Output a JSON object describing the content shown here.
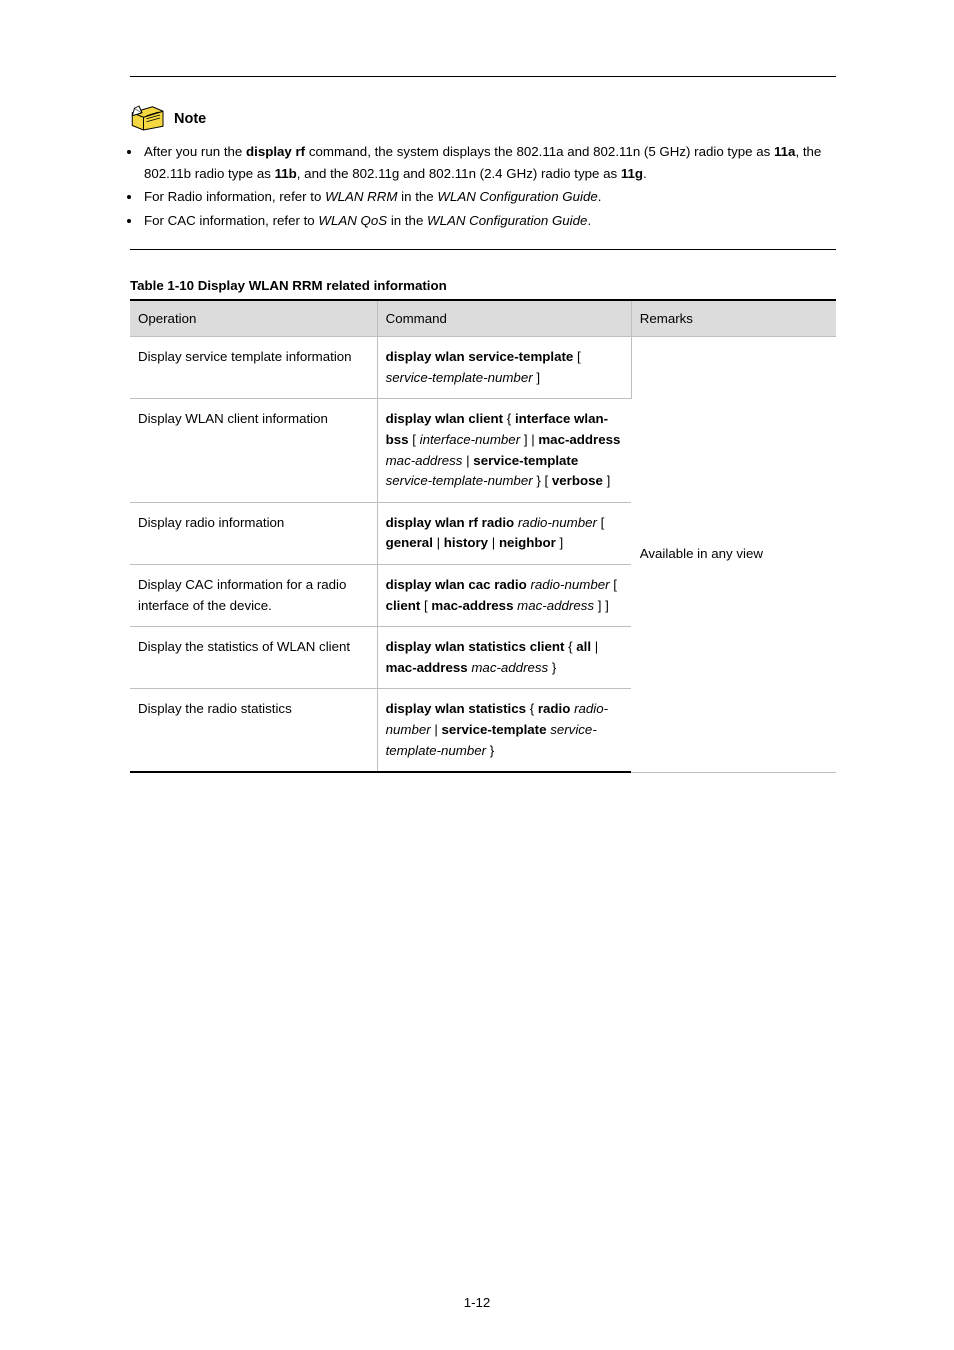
{
  "note": {
    "label": "Note",
    "bullets": [
      [
        "After you run the ",
        {
          "b": true,
          "t": "display rf"
        },
        " command, the system displays the 802.11a and 802.11n (5 GHz) radio type as ",
        {
          "b": true,
          "t": "11a"
        },
        ", the 802.11b radio type as ",
        {
          "b": true,
          "t": "11b"
        },
        ", and the 802.11g and 802.11n (2.4 GHz) radio type as ",
        {
          "b": true,
          "t": "11g"
        },
        "."
      ],
      [
        "For Radio information, refer to ",
        {
          "i": true,
          "t": "WLAN RRM"
        },
        " in the ",
        {
          "i": true,
          "t": "WLAN Configuration Guide"
        },
        "."
      ],
      [
        "For CAC information, refer to ",
        {
          "i": true,
          "t": "WLAN QoS"
        },
        " in the ",
        {
          "i": true,
          "t": "WLAN Configuration Guide"
        },
        "."
      ]
    ]
  },
  "table": {
    "caption": "Table 1-10 Display WLAN RRM related information",
    "headers": {
      "operation": "Operation",
      "command": "Command",
      "remarks": "Remarks"
    },
    "any_view": "Available in any view",
    "rows": [
      {
        "operation": "Display service template information",
        "command": [
          {
            "b": true,
            "t": "display wlan service-template"
          },
          " [ ",
          {
            "i": true,
            "t": "service-template-number"
          },
          " ]"
        ]
      },
      {
        "operation": "Display WLAN client information",
        "command": [
          {
            "b": true,
            "t": "display wlan client"
          },
          " { ",
          {
            "b": true,
            "t": "interface wlan-bss"
          },
          " [ ",
          {
            "i": true,
            "t": "interface-number"
          },
          " ] | ",
          {
            "b": true,
            "t": "mac-address"
          },
          " ",
          {
            "i": true,
            "t": "mac-address"
          },
          " | ",
          {
            "b": true,
            "t": "service-template"
          },
          " ",
          {
            "i": true,
            "t": "service-template-number"
          },
          " } [ ",
          {
            "b": true,
            "t": "verbose"
          },
          " ]"
        ]
      },
      {
        "operation": "Display radio information",
        "command": [
          {
            "b": true,
            "t": "display wlan rf radio"
          },
          " ",
          {
            "i": true,
            "t": "radio-number"
          },
          " [ ",
          {
            "b": true,
            "t": "general"
          },
          " | ",
          {
            "b": true,
            "t": "history"
          },
          " | ",
          {
            "b": true,
            "t": "neighbor"
          },
          " ]"
        ]
      },
      {
        "operation": "Display CAC information for a radio interface of the device.",
        "command": [
          {
            "b": true,
            "t": "display wlan cac radio"
          },
          " ",
          {
            "i": true,
            "t": "radio-number"
          },
          " [ ",
          {
            "b": true,
            "t": "client"
          },
          " [ ",
          {
            "b": true,
            "t": "mac-address"
          },
          " ",
          {
            "i": true,
            "t": "mac-address"
          },
          " ] ]"
        ]
      },
      {
        "operation": "Display the statistics of WLAN client",
        "command": [
          {
            "b": true,
            "t": "display wlan statistics client"
          },
          " { ",
          {
            "b": true,
            "t": "all"
          },
          " | ",
          {
            "b": true,
            "t": "mac-address"
          },
          " ",
          {
            "i": true,
            "t": "mac-address"
          },
          " }"
        ]
      },
      {
        "operation": "Display the radio statistics",
        "command": [
          {
            "b": true,
            "t": "display wlan statistics"
          },
          " { ",
          {
            "b": true,
            "t": "radio"
          },
          " ",
          {
            "i": true,
            "t": "radio-number"
          },
          " | ",
          {
            "b": true,
            "t": "service-template"
          },
          " ",
          {
            "i": true,
            "t": "service-template-number"
          },
          " }"
        ]
      }
    ]
  },
  "pageNumber": "1-12"
}
